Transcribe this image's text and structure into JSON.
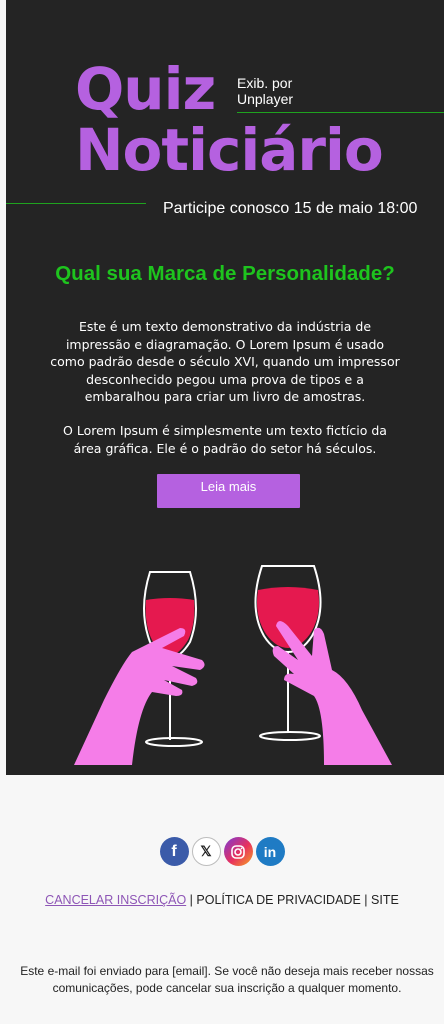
{
  "header": {
    "logo_line1": "Quiz",
    "logo_line2": "Noticiário",
    "byline_line1": "Exib. por",
    "byline_line2": "Unplayer",
    "event": "Participe conosco 15 de maio 18:00"
  },
  "content": {
    "question": "Qual sua Marca de Personalidade?",
    "paragraph1": "Este é um texto demonstrativo da indústria de impressão e diagramação. O Lorem Ipsum é usado como padrão desde o século XVI, quando um impressor desconhecido pegou uma prova de tipos e a embaralhou para criar um livro de amostras.",
    "paragraph2": "O Lorem Ipsum é simplesmente um texto fictício da área gráfica. Ele é o padrão do setor há séculos.",
    "cta_label": "Leia mais"
  },
  "social": {
    "icons": [
      "facebook-icon",
      "x-icon",
      "instagram-icon",
      "linkedin-icon"
    ]
  },
  "footer": {
    "unsubscribe": "CANCELAR INSCRIÇÃO",
    "separator": "|",
    "privacy": "POLÍTICA DE PRIVACIDADE",
    "site": "SITE",
    "disclaimer": "Este e-mail foi enviado para [email]. Se você não deseja mais receber nossas comunicações, pode cancelar sua inscrição a qualquer momento."
  },
  "colors": {
    "hero_bg": "#242424",
    "accent_purple": "#b561e0",
    "accent_green": "#1ec41e",
    "wine": "#e5194f",
    "hand": "#f57de8"
  }
}
